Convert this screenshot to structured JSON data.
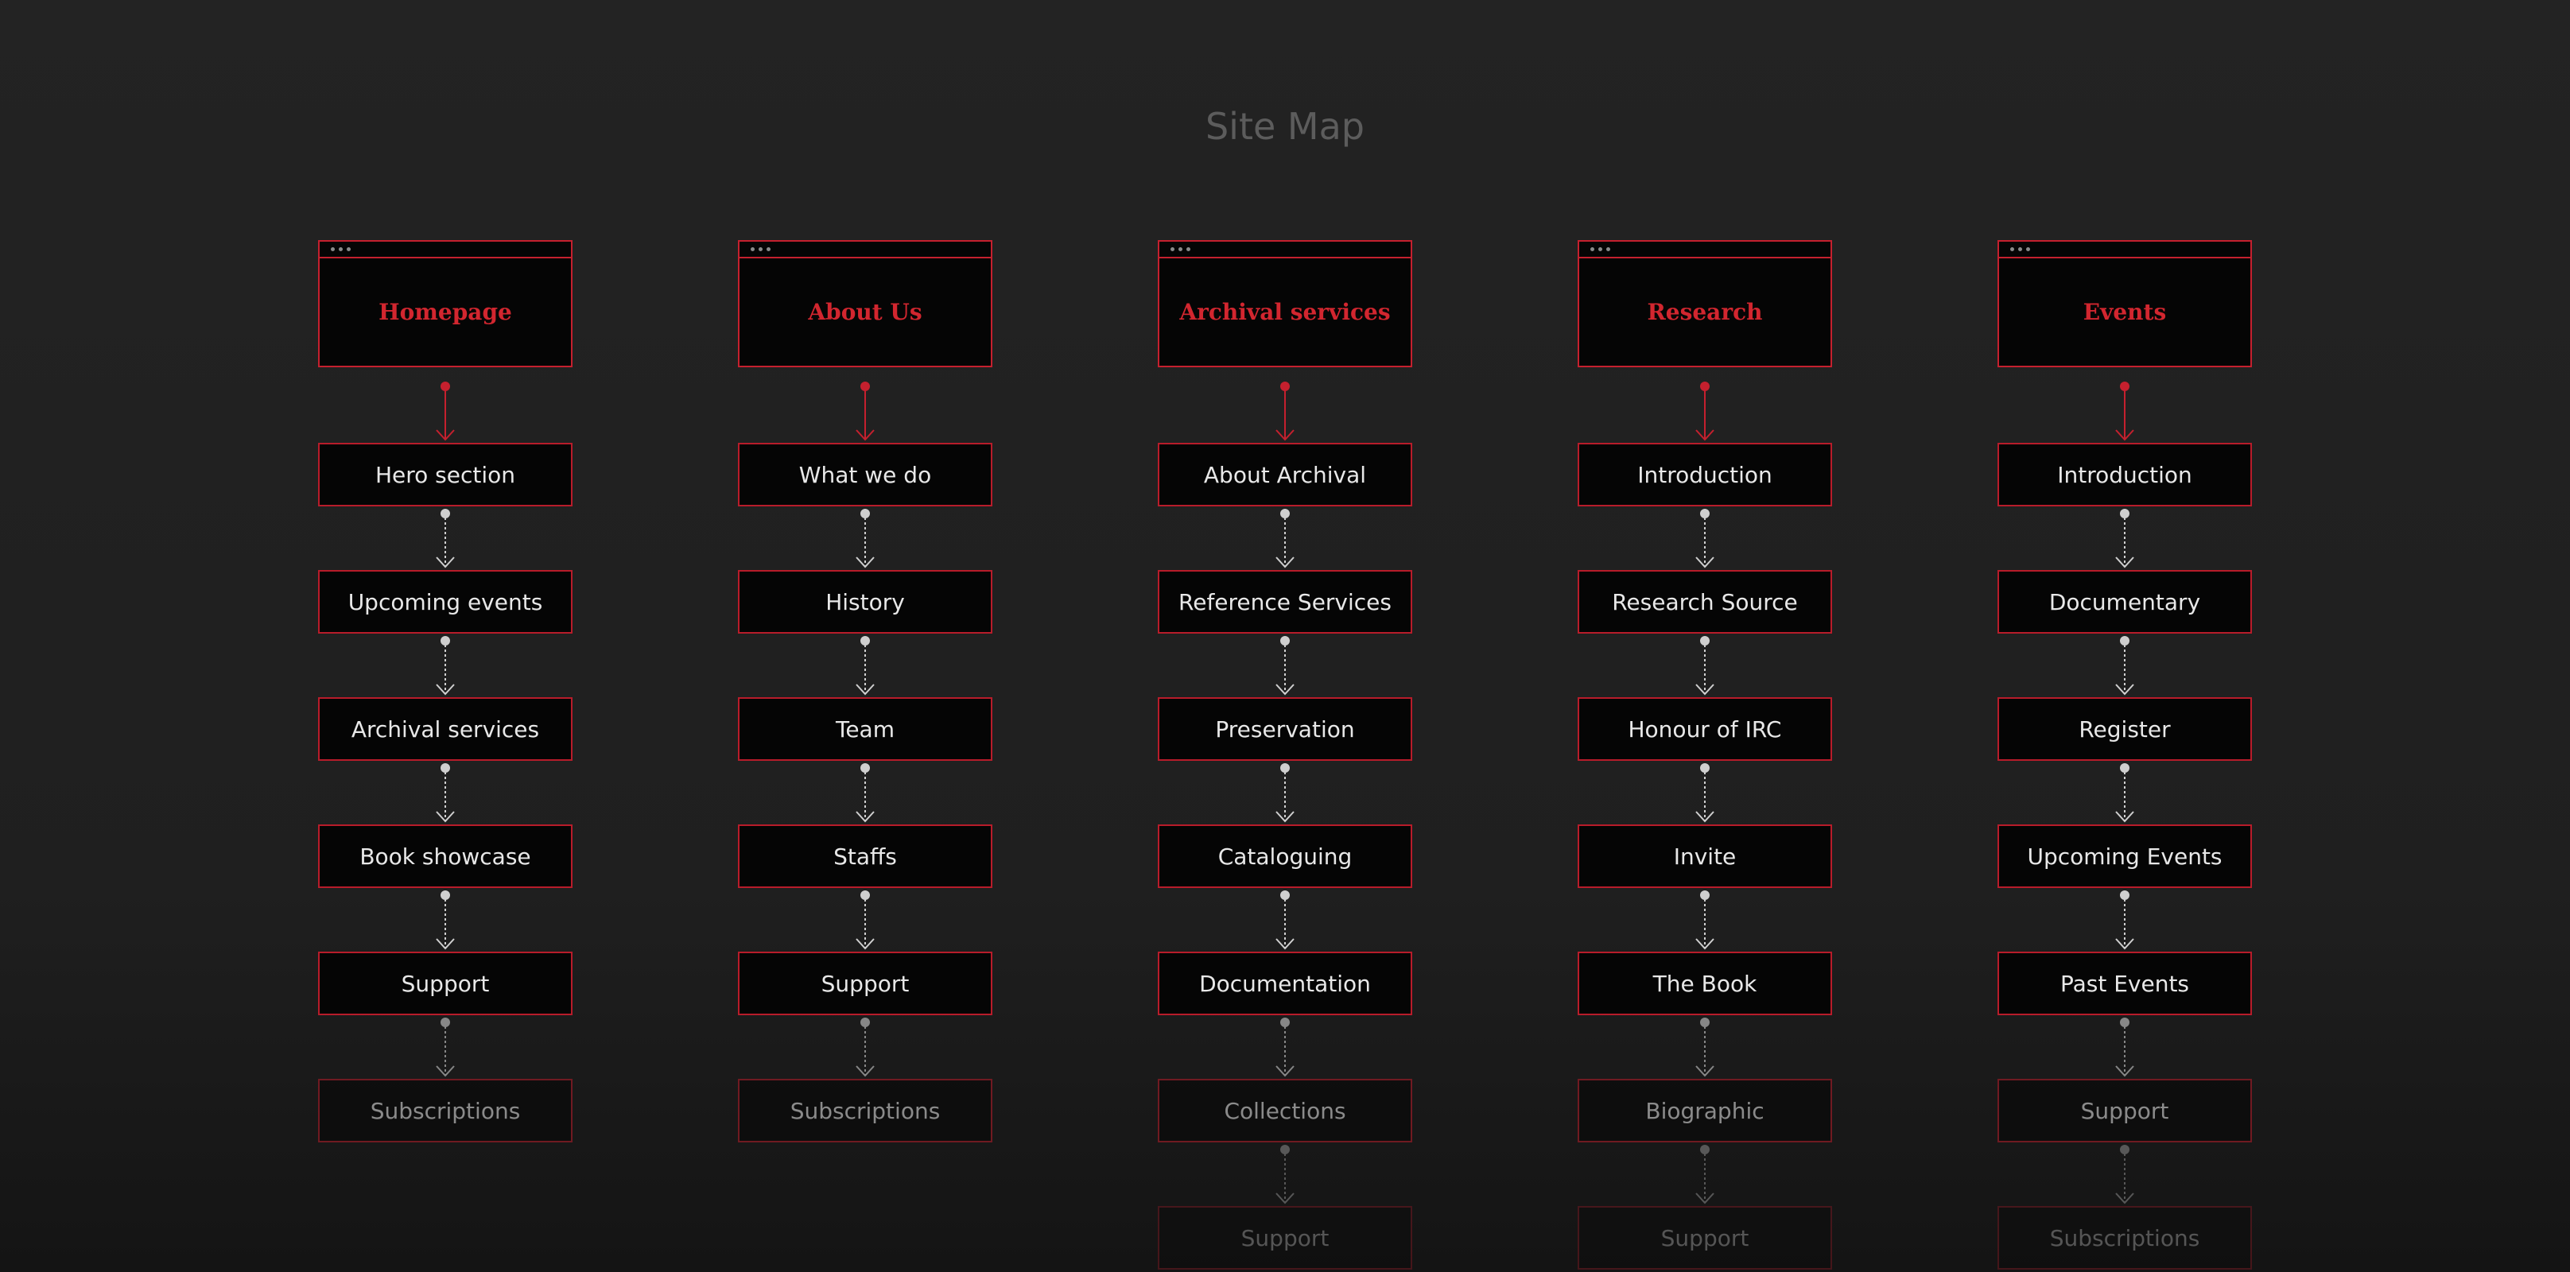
{
  "page": {
    "title": "Site Map"
  },
  "colors": {
    "background": "#1f1f1f",
    "accent": "#c5202e",
    "title_text": "#5c5c5c",
    "node_text": "#e8e8e8",
    "connector": "#cfcfcf"
  },
  "icons": {
    "window_dots": "window-dots-icon",
    "primary_arrow": "arrow-down-icon",
    "secondary_arrow": "dashed-arrow-down-icon"
  },
  "columns": [
    {
      "title": "Homepage",
      "items": [
        "Hero section",
        "Upcoming events",
        "Archival services",
        "Book showcase",
        "Support",
        "Subscriptions"
      ]
    },
    {
      "title": "About Us",
      "items": [
        "What we do",
        "History",
        "Team",
        "Staffs",
        "Support",
        "Subscriptions"
      ]
    },
    {
      "title": "Archival services",
      "items": [
        "About Archival",
        "Reference Services",
        "Preservation",
        "Cataloguing",
        "Documentation",
        "Collections",
        "Support"
      ]
    },
    {
      "title": "Research",
      "items": [
        "Introduction",
        "Research Source",
        "Honour of IRC",
        "Invite",
        "The Book",
        "Biographic",
        "Support"
      ]
    },
    {
      "title": "Events",
      "items": [
        "Introduction",
        "Documentary",
        "Register",
        "Upcoming Events",
        "Past Events",
        "Support",
        "Subscriptions"
      ]
    }
  ]
}
